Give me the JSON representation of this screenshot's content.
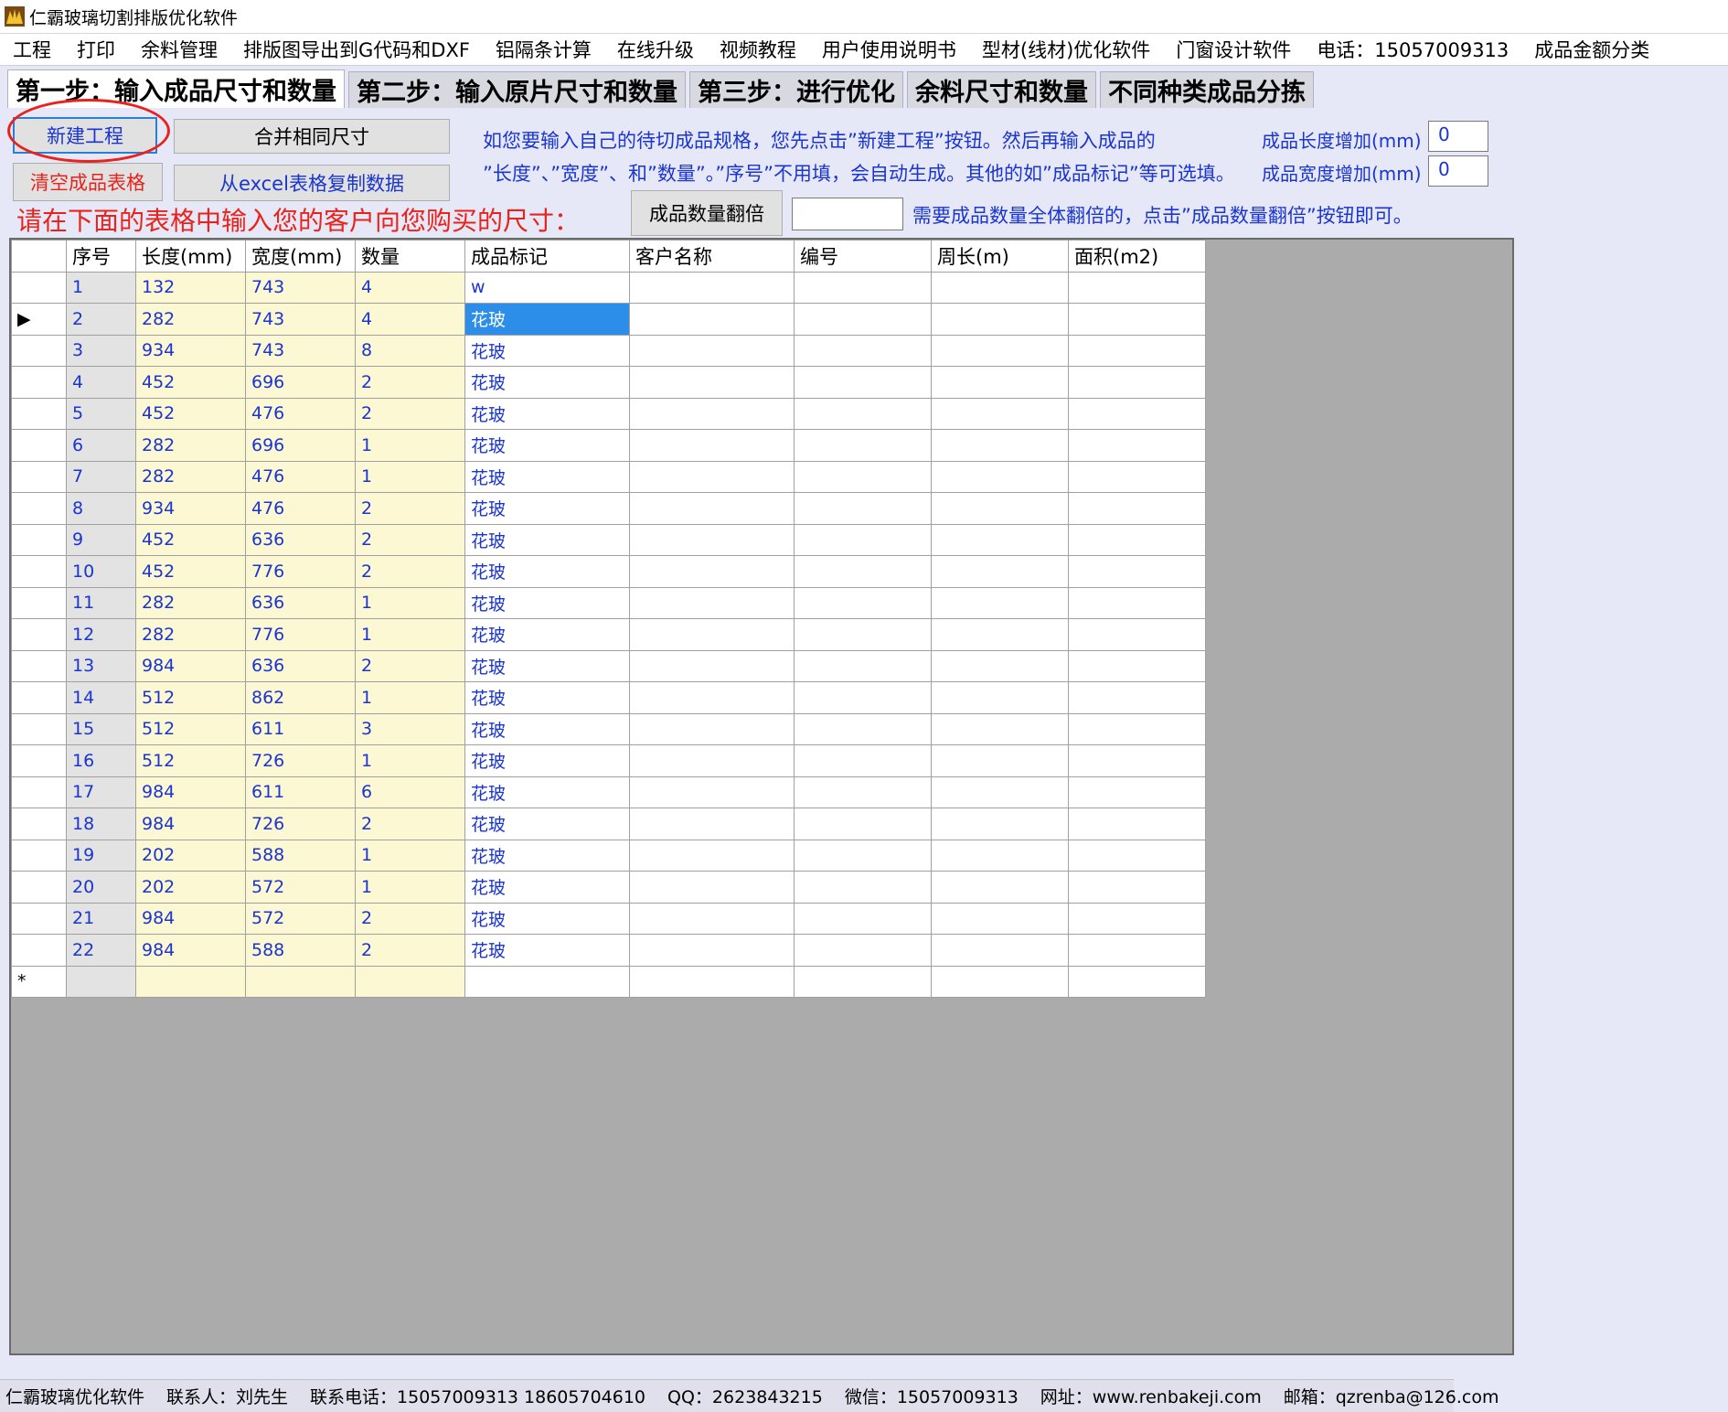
{
  "window": {
    "title": "仁霸玻璃切割排版优化软件"
  },
  "menu": [
    "工程",
    "打印",
    "余料管理",
    "排版图导出到G代码和DXF",
    "铝隔条计算",
    "在线升级",
    "视频教程",
    "用户使用说明书",
    "型材(线材)优化软件",
    "门窗设计软件",
    "电话：15057009313",
    "成品金额分类"
  ],
  "tabs": [
    "第一步：输入成品尺寸和数量",
    "第二步：输入原片尺寸和数量",
    "第三步：进行优化",
    "余料尺寸和数量",
    "不同种类成品分拣"
  ],
  "toolbar": {
    "new_project": "新建工程",
    "merge_sizes": "合并相同尺寸",
    "clear_table": "清空成品表格",
    "copy_excel": "从excel表格复制数据",
    "multiply_qty": "成品数量翻倍",
    "multiply_value": ""
  },
  "info": {
    "line1": "如您要输入自己的待切成品规格，您先点击”新建工程”按钮。然后再输入成品的",
    "line2": "”长度”、”宽度”、和”数量”。”序号”不用填，会自动生成。其他的如”成品标记”等可选填。",
    "prompt": "请在下面的表格中输入您的客户向您购买的尺寸：",
    "multiply_hint": "需要成品数量全体翻倍的，点击”成品数量翻倍”按钮即可。"
  },
  "adjust": {
    "length_label": "成品长度增加(mm)",
    "length_value": "0",
    "width_label": "成品宽度增加(mm)",
    "width_value": "0"
  },
  "grid": {
    "columns": [
      "序号",
      "长度(mm)",
      "宽度(mm)",
      "数量",
      "成品标记",
      "客户名称",
      "编号",
      "周长(m)",
      "面积(m2)"
    ],
    "current_row_marker": "▶",
    "new_row_marker": "*",
    "rows": [
      [
        "1",
        "132",
        "743",
        "4",
        "w"
      ],
      [
        "2",
        "282",
        "743",
        "4",
        "花玻"
      ],
      [
        "3",
        "934",
        "743",
        "8",
        "花玻"
      ],
      [
        "4",
        "452",
        "696",
        "2",
        "花玻"
      ],
      [
        "5",
        "452",
        "476",
        "2",
        "花玻"
      ],
      [
        "6",
        "282",
        "696",
        "1",
        "花玻"
      ],
      [
        "7",
        "282",
        "476",
        "1",
        "花玻"
      ],
      [
        "8",
        "934",
        "476",
        "2",
        "花玻"
      ],
      [
        "9",
        "452",
        "636",
        "2",
        "花玻"
      ],
      [
        "10",
        "452",
        "776",
        "2",
        "花玻"
      ],
      [
        "11",
        "282",
        "636",
        "1",
        "花玻"
      ],
      [
        "12",
        "282",
        "776",
        "1",
        "花玻"
      ],
      [
        "13",
        "984",
        "636",
        "2",
        "花玻"
      ],
      [
        "14",
        "512",
        "862",
        "1",
        "花玻"
      ],
      [
        "15",
        "512",
        "611",
        "3",
        "花玻"
      ],
      [
        "16",
        "512",
        "726",
        "1",
        "花玻"
      ],
      [
        "17",
        "984",
        "611",
        "6",
        "花玻"
      ],
      [
        "18",
        "984",
        "726",
        "2",
        "花玻"
      ],
      [
        "19",
        "202",
        "588",
        "1",
        "花玻"
      ],
      [
        "20",
        "202",
        "572",
        "1",
        "花玻"
      ],
      [
        "21",
        "984",
        "572",
        "2",
        "花玻"
      ],
      [
        "22",
        "984",
        "588",
        "2",
        "花玻"
      ]
    ]
  },
  "status": [
    "仁霸玻璃优化软件",
    "联系人：刘先生",
    "联系电话：15057009313 18605704610",
    "QQ：2623843215",
    "微信：15057009313",
    "网址：www.renbakeji.com",
    "邮箱：qzrenba@126.com"
  ],
  "colors": {
    "accent_blue": "#1a35d0",
    "alert_red": "#e8231c",
    "selection": "#2c8ee8",
    "input_yellow": "#fdf8d4"
  }
}
